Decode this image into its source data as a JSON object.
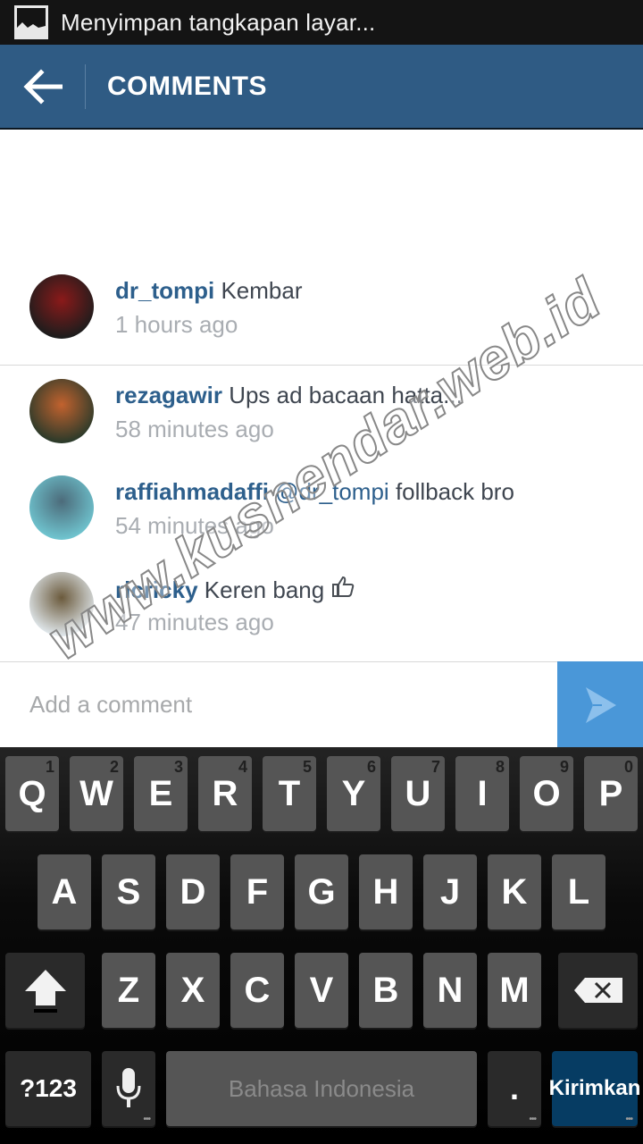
{
  "status_bar": {
    "notification_icon": "screenshot-image-icon",
    "text": "Menyimpan tangkapan layar..."
  },
  "header": {
    "back_icon": "arrow-left-icon",
    "title": "COMMENTS"
  },
  "comments": [
    {
      "username": "dr_tompi",
      "mention": "",
      "text": "Kembar",
      "emoji": "",
      "time": "1 hours ago",
      "avatar_colors": [
        "#1c1c1c",
        "#8b1a1a"
      ]
    },
    {
      "username": "rezagawir",
      "mention": "",
      "text": "Ups ad bacaan hatta...",
      "emoji": "",
      "time": "58 minutes ago",
      "avatar_colors": [
        "#2b3a2a",
        "#c2622e"
      ]
    },
    {
      "username": "raffiahmadaffi",
      "mention": "@dr_tompi",
      "text": "follback bro",
      "emoji": "",
      "time": "54 minutes ago",
      "avatar_colors": [
        "#6fc4cf",
        "#4c6b7a"
      ]
    },
    {
      "username": "ricricky",
      "mention": "",
      "text": "Keren bang",
      "emoji": "👍",
      "time": "47 minutes ago",
      "avatar_colors": [
        "#dfe6ea",
        "#6b5a3c"
      ]
    }
  ],
  "comment_input": {
    "placeholder": "Add a comment",
    "value": "",
    "send_icon": "send-arrow-icon"
  },
  "keyboard": {
    "row1": [
      {
        "label": "Q",
        "hint": "1"
      },
      {
        "label": "W",
        "hint": "2"
      },
      {
        "label": "E",
        "hint": "3"
      },
      {
        "label": "R",
        "hint": "4"
      },
      {
        "label": "T",
        "hint": "5"
      },
      {
        "label": "Y",
        "hint": "6"
      },
      {
        "label": "U",
        "hint": "7"
      },
      {
        "label": "I",
        "hint": "8"
      },
      {
        "label": "O",
        "hint": "9"
      },
      {
        "label": "P",
        "hint": "0"
      }
    ],
    "row2": [
      "A",
      "S",
      "D",
      "F",
      "G",
      "H",
      "J",
      "K",
      "L"
    ],
    "row3": [
      "Z",
      "X",
      "C",
      "V",
      "B",
      "N",
      "M"
    ],
    "shift_icon": "shift-arrow-icon",
    "backspace_icon": "backspace-icon",
    "symbols_label": "?123",
    "mic_icon": "microphone-icon",
    "space_label": "Bahasa Indonesia",
    "period_label": ".",
    "send_label": "Kirimkan"
  },
  "colors": {
    "header_bg": "#2f5b84",
    "username": "#2d5f8c",
    "send_button": "#4a97d8",
    "keyboard_send": "#063c63"
  },
  "watermark": "www.kusnendar.web.id"
}
